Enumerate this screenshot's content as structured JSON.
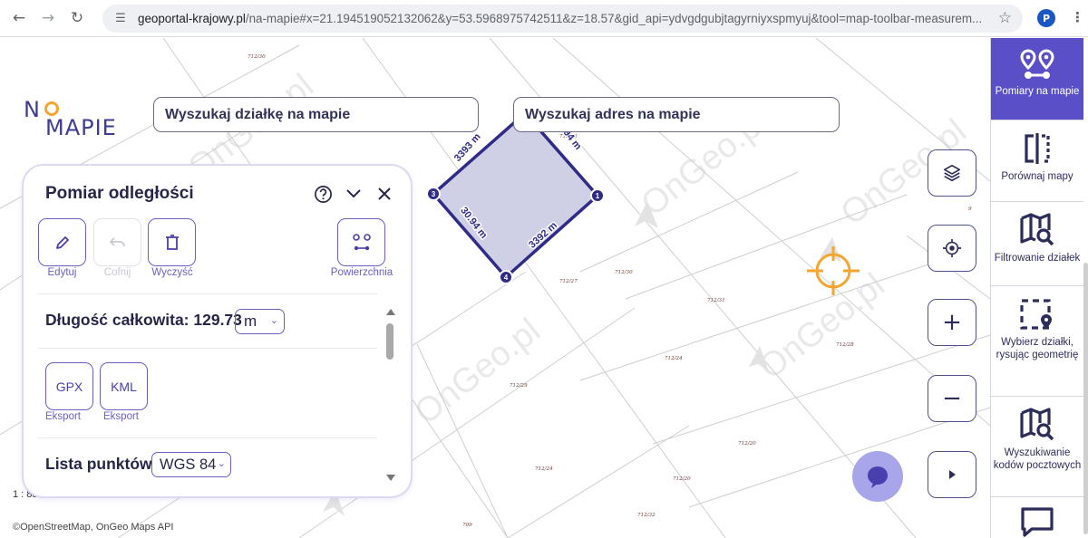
{
  "browser": {
    "url_host": "geoportal-krajowy.pl",
    "url_rest": "/na-mapie#x=21.194519052132062&y=53.5968975742511&z=18.57&gid_api=ydvgdgubjtagyrniyxspmyuj&tool=map-toolbar-measurem...",
    "profile_initial": "P"
  },
  "logo": {
    "line1": "N",
    "line2": "MAPIE"
  },
  "search": {
    "parcel_placeholder": "Wyszukaj działkę na mapie",
    "address_placeholder": "Wyszukaj adres na mapie"
  },
  "panel": {
    "title": "Pomiar odległości",
    "tools": [
      {
        "label": "Edytuj",
        "icon": "pencil-icon",
        "enabled": true
      },
      {
        "label": "Cofnij",
        "icon": "undo-icon",
        "enabled": false
      },
      {
        "label": "Wyczyść",
        "icon": "trash-icon",
        "enabled": true
      },
      {
        "label": "Powierzchnia",
        "icon": "area-icon",
        "enabled": true
      }
    ],
    "total_label": "Długość całkowita: 129.73",
    "unit": "m",
    "exports": [
      {
        "format": "GPX",
        "label": "Eksport"
      },
      {
        "format": "KML",
        "label": "Eksport"
      }
    ],
    "points_label": "Lista punktów",
    "crs": "WGS 84"
  },
  "measurement": {
    "vertices": [
      "1",
      "2",
      "3",
      "4"
    ],
    "segments": [
      "3393 m",
      "30.94 m",
      "3392 m",
      "30.94 m"
    ]
  },
  "parcels": [
    "712/31",
    "712/30",
    "712/26",
    "712/27",
    "712/27",
    "712/30",
    "712/31",
    "712/28",
    "712/24",
    "712/29",
    "712/20",
    "712/24",
    "712/20",
    "712/32",
    "709",
    "9"
  ],
  "watermark": "OnGeo.pl",
  "scale": "1 : 881",
  "attribution": "©OpenStreetMap, OnGeo Maps API",
  "sidebar": {
    "items": [
      {
        "label": "Pomiary na mapie",
        "icon": "measure-icon",
        "active": true
      },
      {
        "label": "Porównaj mapy",
        "icon": "compare-icon",
        "active": false
      },
      {
        "label": "Filtrowanie działek",
        "icon": "map-filter-icon",
        "active": false
      },
      {
        "label": "Wybierz działki, rysując geometrię",
        "icon": "select-geometry-icon",
        "active": false
      },
      {
        "label": "Wyszukiwanie kodów pocztowych",
        "icon": "postal-code-icon",
        "active": false
      },
      {
        "label": "",
        "icon": "chat-icon",
        "active": false
      }
    ]
  },
  "colors": {
    "accent": "#5b4fc7",
    "polygon_fill": "#cfd0e6",
    "polygon_stroke": "#2f2b87",
    "crosshair": "#f4a630",
    "chat_bubble": "#a9a5eb"
  }
}
